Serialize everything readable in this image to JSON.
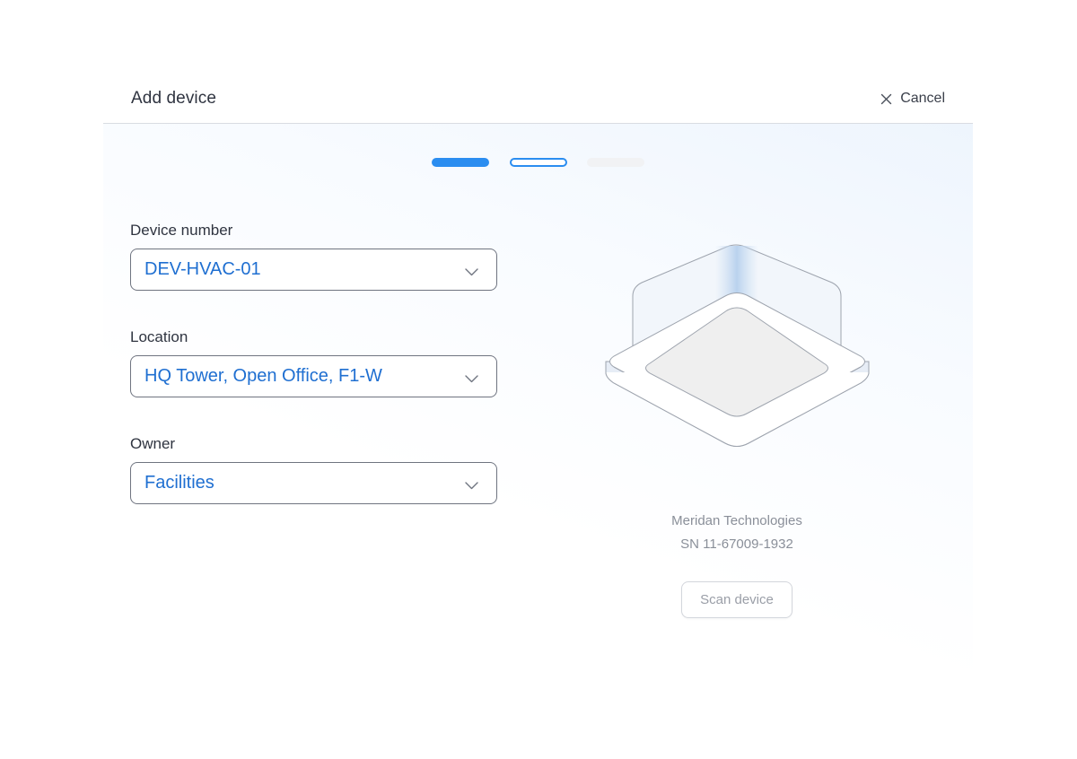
{
  "header": {
    "title": "Add device",
    "cancel_label": "Cancel"
  },
  "stepper": {
    "steps": [
      {
        "state": "completed"
      },
      {
        "state": "current"
      },
      {
        "state": "upcoming"
      }
    ]
  },
  "form": {
    "device_number": {
      "label": "Device number",
      "value": "DEV-HVAC-01"
    },
    "location": {
      "label": "Location",
      "value": "HQ Tower, Open Office, F1-W"
    },
    "owner": {
      "label": "Owner",
      "value": "Facilities"
    }
  },
  "device": {
    "manufacturer": "Meridan Technologies",
    "serial": "SN 11-67009-1932",
    "scan_label": "Scan device",
    "icon": "ceiling-hvac-unit"
  },
  "colors": {
    "accent": "#2b8df0",
    "value_text": "#1f6fd1",
    "muted_text": "#8a8f99"
  }
}
